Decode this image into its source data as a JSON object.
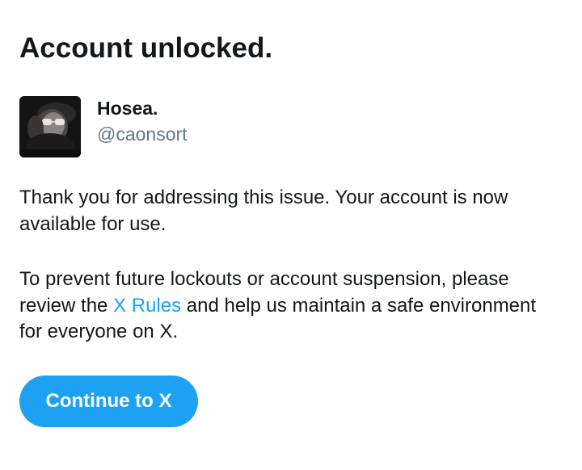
{
  "header": {
    "title": "Account unlocked."
  },
  "profile": {
    "display_name": "Hosea.",
    "handle": "@caonsort",
    "avatar_icon": "user-avatar-photo"
  },
  "message": {
    "paragraph1": "Thank you for addressing this issue. Your account is now available for use.",
    "paragraph2_before": "To prevent future lockouts or account suspension, please review the ",
    "paragraph2_link": "X Rules",
    "paragraph2_after": " and help us maintain a safe environment for everyone on X."
  },
  "actions": {
    "continue_label": "Continue to X"
  },
  "colors": {
    "accent": "#1da1f2",
    "text_primary": "#14171a",
    "text_secondary": "#657786"
  }
}
